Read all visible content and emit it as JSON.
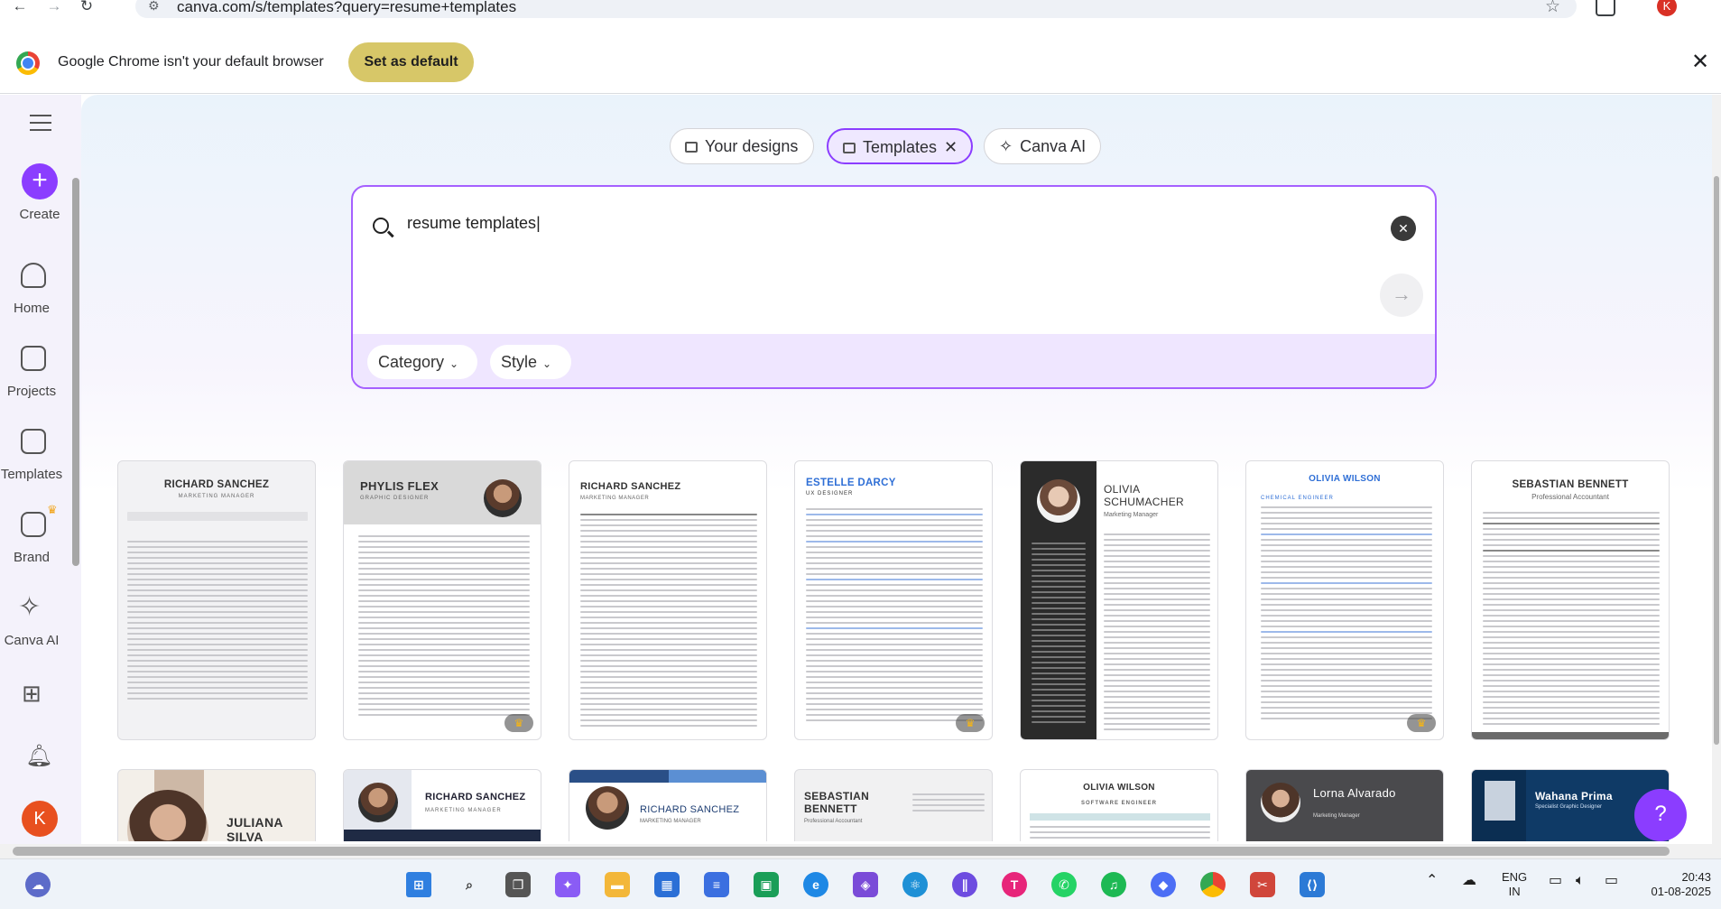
{
  "browser": {
    "url": "canva.com/s/templates?query=resume+templates",
    "profile_initial": "K"
  },
  "infobar": {
    "message": "Google Chrome isn't your default browser",
    "set_default_label": "Set as default",
    "close_label": "✕"
  },
  "sidebar": {
    "create_label": "Create",
    "items": [
      {
        "label": "Home",
        "icon": "home-icon"
      },
      {
        "label": "Projects",
        "icon": "folder-icon"
      },
      {
        "label": "Templates",
        "icon": "templates-icon"
      },
      {
        "label": "Brand",
        "icon": "brand-icon"
      },
      {
        "label": "Canva AI",
        "icon": "sparkle-icon"
      }
    ],
    "user_initial": "K"
  },
  "search_tabs": [
    {
      "label": "Your designs",
      "icon": "folder-icon",
      "active": false
    },
    {
      "label": "Templates",
      "icon": "templates-icon",
      "active": true
    },
    {
      "label": "Canva AI",
      "icon": "sparkle-icon",
      "active": false
    }
  ],
  "search": {
    "query": "resume templates",
    "filters": [
      {
        "label": "Category"
      },
      {
        "label": "Style"
      }
    ]
  },
  "templates_row1": [
    {
      "name": "RICHARD SANCHEZ",
      "role": "MARKETING MANAGER",
      "premium": false
    },
    {
      "name": "PHYLIS FLEX",
      "role": "GRAPHIC DESIGNER",
      "premium": true
    },
    {
      "name": "RICHARD SANCHEZ",
      "role": "MARKETING MANAGER",
      "premium": false
    },
    {
      "name": "ESTELLE DARCY",
      "role": "UX DESIGNER",
      "premium": true
    },
    {
      "name": "OLIVIA SCHUMACHER",
      "role": "Marketing Manager",
      "premium": false
    },
    {
      "name": "OLIVIA WILSON",
      "role": "CHEMICAL ENGINEER",
      "premium": true
    },
    {
      "name": "SEBASTIAN BENNETT",
      "role": "Professional Accountant",
      "premium": false
    }
  ],
  "templates_row2": [
    {
      "name": "JULIANA SILVA",
      "role": ""
    },
    {
      "name": "RICHARD SANCHEZ",
      "role": "MARKETING MANAGER"
    },
    {
      "name": "RICHARD SANCHEZ",
      "role": "MARKETING MANAGER"
    },
    {
      "name": "SEBASTIAN BENNETT",
      "role": "Professional Accountant"
    },
    {
      "name": "OLIVIA WILSON",
      "role": "SOFTWARE ENGINEER"
    },
    {
      "name": "Lorna Alvarado",
      "role": "Marketing Manager"
    },
    {
      "name": "Wahana Prima",
      "role": "Specialist Graphic Designer"
    }
  ],
  "help_label": "?",
  "taskbar": {
    "lang_line1": "ENG",
    "lang_line2": "IN",
    "time": "20:43",
    "date": "01-08-2025"
  },
  "colors": {
    "canva_purple": "#8b3dff",
    "set_default_bg": "#d7c768",
    "avatar_orange": "#e8501f"
  }
}
